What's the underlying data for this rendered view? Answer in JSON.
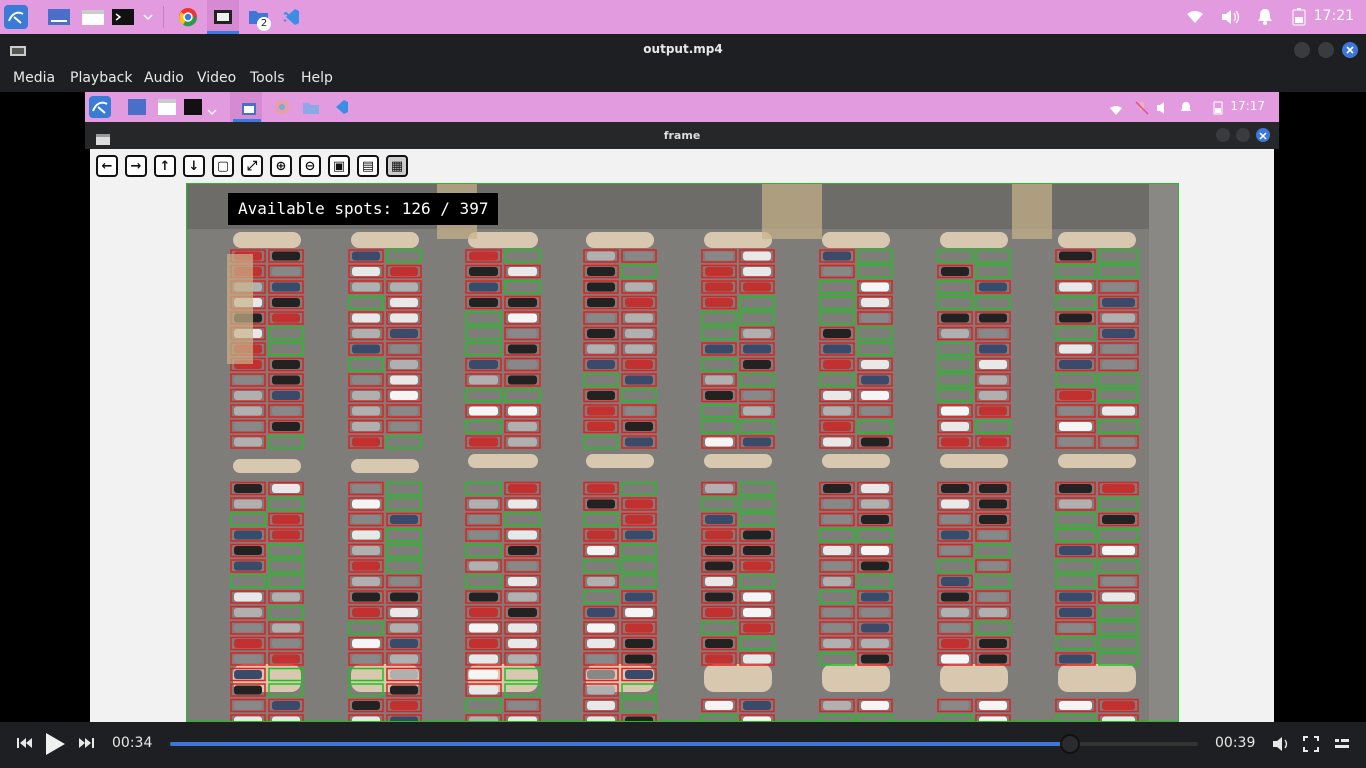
{
  "os_taskbar": {
    "time": "17:21",
    "badge_count": "2",
    "icons": [
      "kali-menu-icon",
      "workspace-icon",
      "file-manager-icon",
      "terminal-icon",
      "chrome-icon",
      "video-player-icon",
      "folder-icon",
      "vscode-icon",
      "wifi-icon",
      "volume-icon",
      "bell-icon",
      "battery-icon"
    ]
  },
  "vlc": {
    "title": "output.mp4",
    "menu": [
      "Media",
      "Playback",
      "Audio",
      "Video",
      "Tools",
      "Help"
    ],
    "elapsed": "00:34",
    "duration": "00:39",
    "progress": 0.875
  },
  "inner_taskbar": {
    "time": "17:17"
  },
  "frame_window": {
    "title": "frame",
    "toolbar": [
      "←",
      "→",
      "↑",
      "↓",
      "▢",
      "⤢",
      "⊕",
      "⊖",
      "▣",
      "▤",
      "▦"
    ],
    "overlay_text": "Available spots: 126 / 397"
  },
  "colors": {
    "taskbar": "#e39be0",
    "occupied_box": "#e02020",
    "free_box": "#20c020",
    "accent": "#3d78d8"
  }
}
